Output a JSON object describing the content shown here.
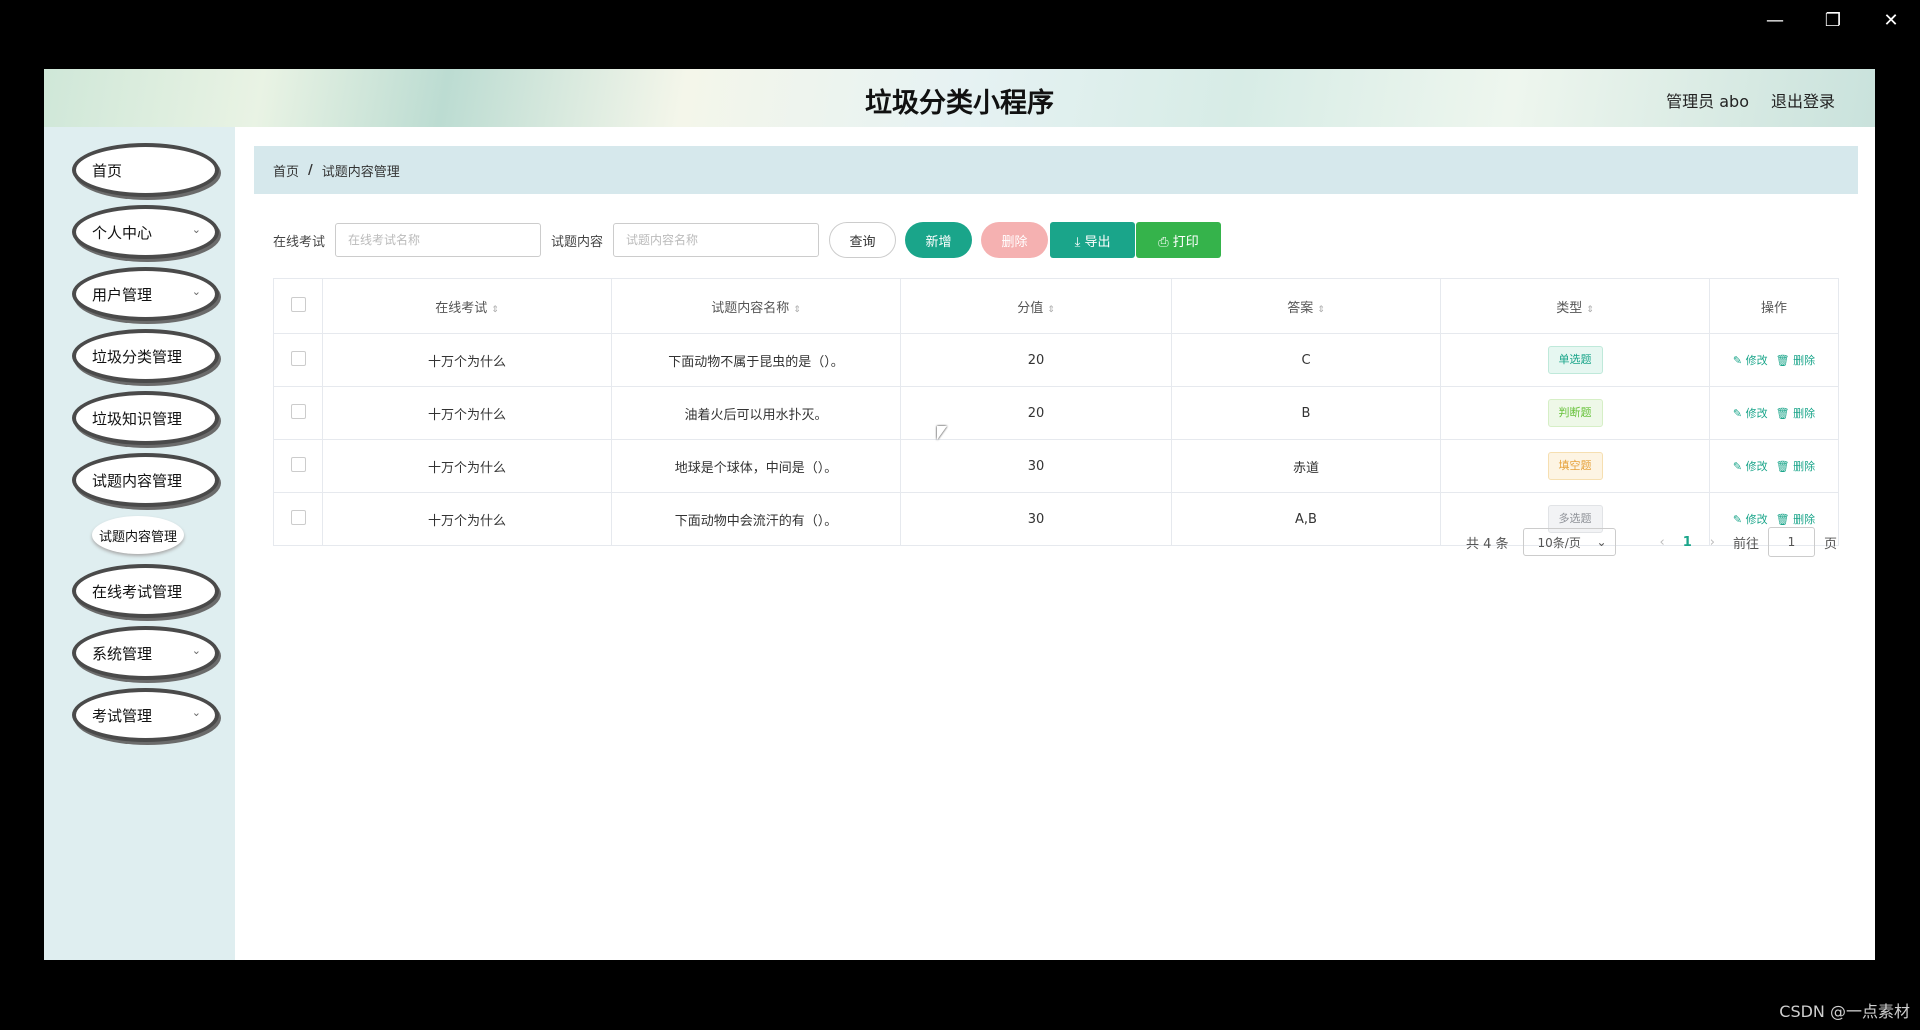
{
  "window": {
    "minimize": "—",
    "restore": "❐",
    "close": "✕"
  },
  "header": {
    "title": "垃圾分类小程序",
    "user": "管理员 abo",
    "logout": "退出登录"
  },
  "sidebar": {
    "items": [
      {
        "label": "首页"
      },
      {
        "label": "个人中心"
      },
      {
        "label": "用户管理"
      },
      {
        "label": "垃圾分类管理"
      },
      {
        "label": "垃圾知识管理"
      },
      {
        "label": "试题内容管理"
      },
      {
        "label": "在线考试管理"
      },
      {
        "label": "系统管理"
      },
      {
        "label": "考试管理"
      }
    ],
    "sub_item": "试题内容管理",
    "chevron": "⌄"
  },
  "breadcrumb": {
    "home": "首页",
    "sep": "/",
    "current": "试题内容管理"
  },
  "filters": {
    "exam_label": "在线考试",
    "exam_placeholder": "在线考试名称",
    "content_label": "试题内容",
    "content_placeholder": "试题内容名称"
  },
  "buttons": {
    "query": "查询",
    "add": "新增",
    "delete": "删除",
    "export": "⤓ 导出",
    "print": "⎙ 打印"
  },
  "table": {
    "headers": [
      "在线考试",
      "试题内容名称",
      "分值",
      "答案",
      "类型",
      "操作"
    ],
    "sort_icon": "⇕",
    "rows": [
      {
        "exam": "十万个为什么",
        "content": "下面动物不属于昆虫的是（）。",
        "score": "20",
        "answer": "C",
        "type": "单选题"
      },
      {
        "exam": "十万个为什么",
        "content": "油着火后可以用水扑灭。",
        "score": "20",
        "answer": "B",
        "type": "判断题"
      },
      {
        "exam": "十万个为什么",
        "content": "地球是个球体，中间是（）。",
        "score": "30",
        "answer": "赤道",
        "type": "填空题"
      },
      {
        "exam": "十万个为什么",
        "content": "下面动物中会流汗的有（）。",
        "score": "30",
        "answer": "A,B",
        "type": "多选题"
      }
    ],
    "edit_label": "✎ 修改",
    "delete_label": "🗑 删除"
  },
  "pagination": {
    "total": "共 4 条",
    "page_size": "10条/页",
    "prev": "‹",
    "current": "1",
    "next": "›",
    "goto_label": "前往",
    "goto_value": "1",
    "page_suffix": "页"
  },
  "watermark": "CSDN @一点素材"
}
